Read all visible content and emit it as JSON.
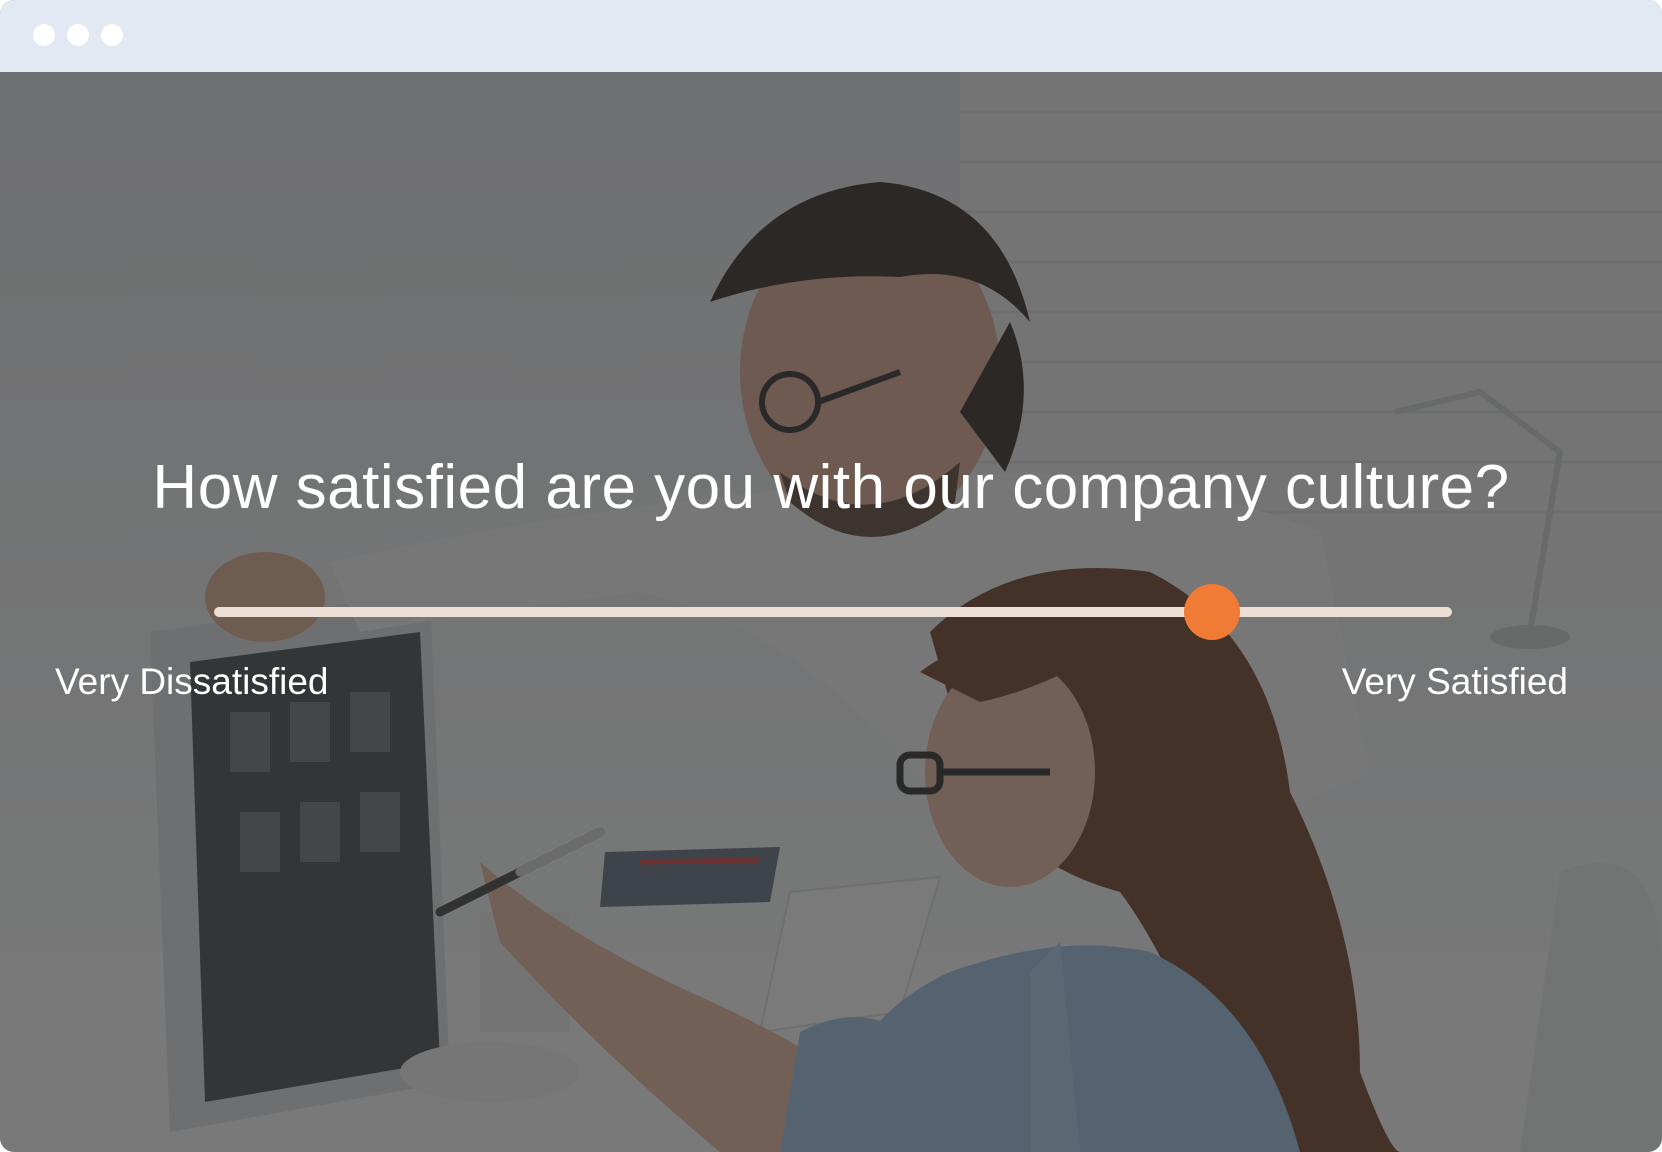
{
  "window": {
    "dots": [
      "dot",
      "dot",
      "dot"
    ]
  },
  "survey": {
    "question": "How satisfied are you with our company culture?",
    "min_label": "Very Dissatisfied",
    "max_label": "Very Satisfied",
    "slider_value_fraction": 0.806
  },
  "colors": {
    "accent": "#ef7b35",
    "track": "#ece0d6",
    "titlebar": "#e2e9f2",
    "text": "#ffffff"
  }
}
